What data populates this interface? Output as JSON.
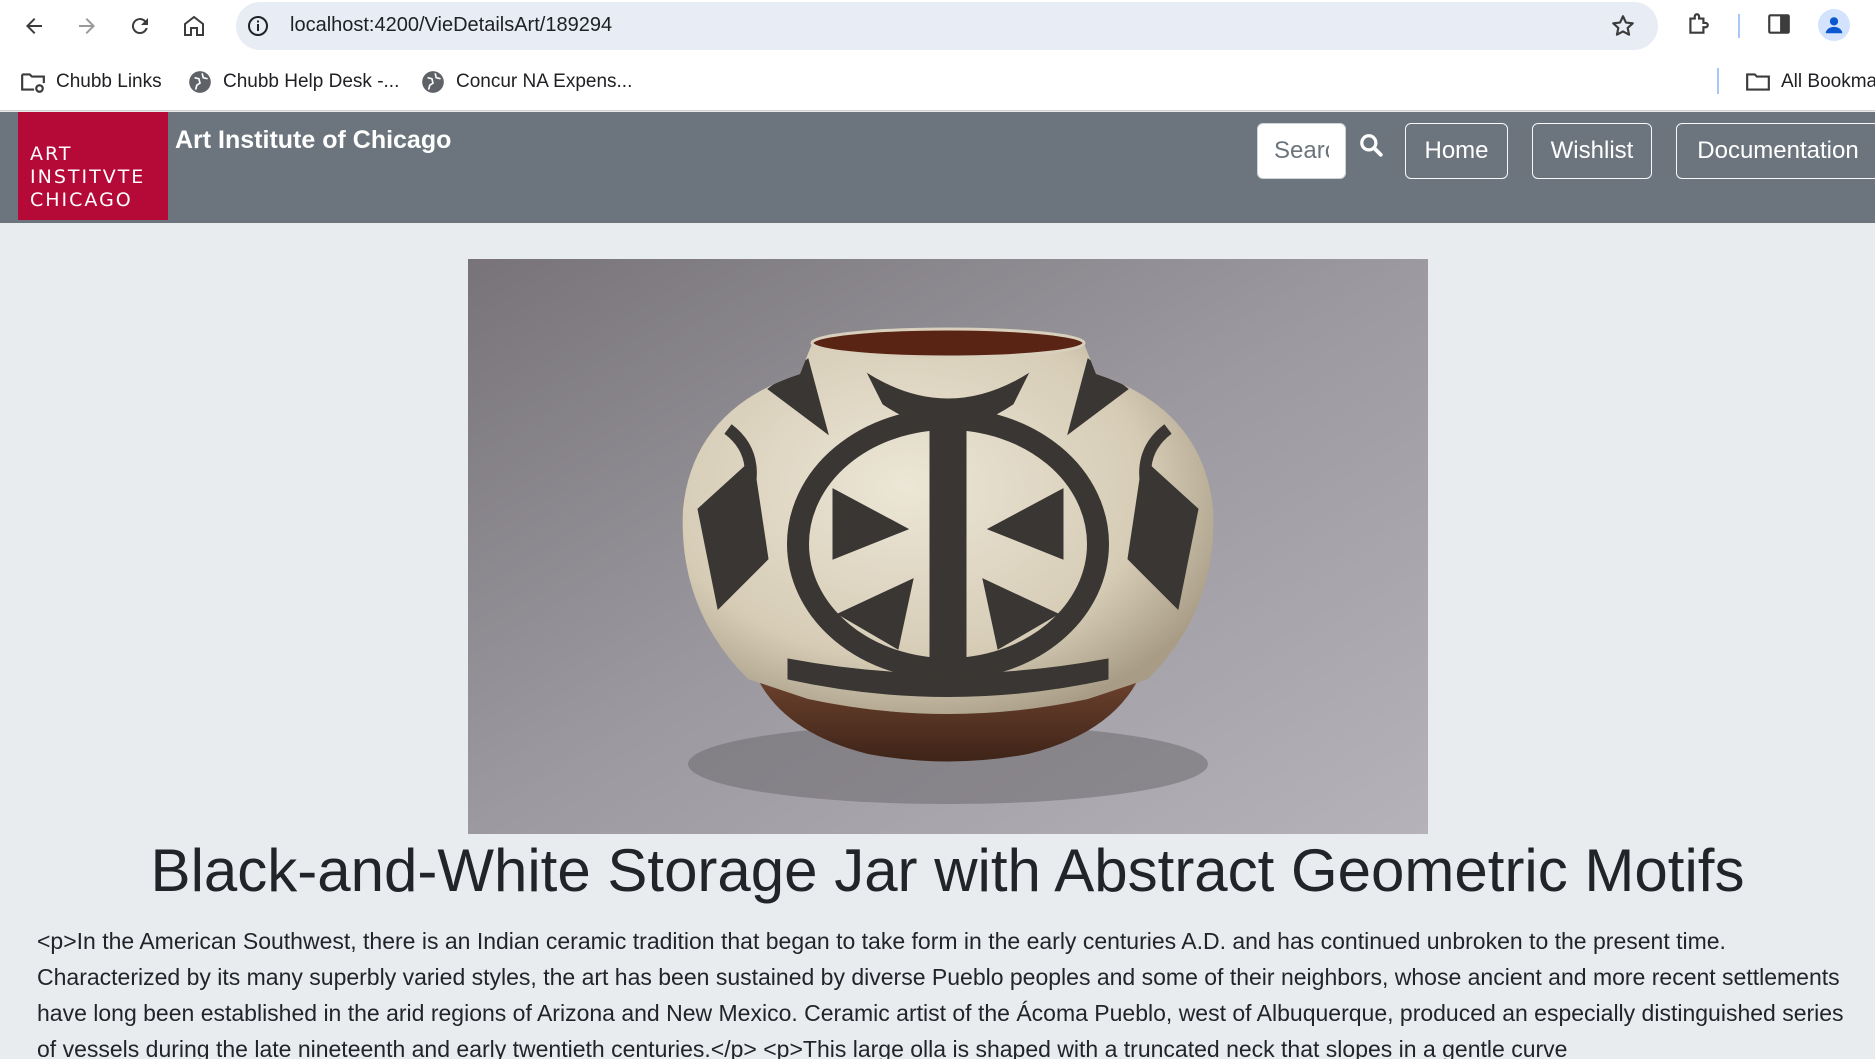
{
  "browser": {
    "url": "localhost:4200/VieDetailsArt/189294",
    "bookmarks": [
      {
        "label": "Chubb Links"
      },
      {
        "label": "Chubb Help Desk -..."
      },
      {
        "label": "Concur NA Expens..."
      }
    ],
    "all_bookmarks_label": "All Bookma"
  },
  "navbar": {
    "logo_lines": [
      "ART",
      "INSTITVTE",
      "CHICAGO"
    ],
    "brand": "Art Institute of Chicago",
    "search_placeholder": "Search",
    "links": [
      "Home",
      "Wishlist",
      "Documentation"
    ],
    "bg_color": "#6c757d",
    "logo_color": "#b50938"
  },
  "artwork": {
    "title": "Black-and-White Storage Jar with Abstract Geometric Motifs",
    "description": "<p>In the American Southwest, there is an Indian ceramic tradition that began to take form in the early centuries A.D. and has continued unbroken to the present time. Characterized by its many superbly varied styles, the art has been sustained by diverse Pueblo peoples and some of their neighbors, whose ancient and more recent settlements have long been established in the arid regions of Arizona and New Mexico. Ceramic artist of the Ácoma Pueblo, west of Albuquerque, produced an especially distinguished series of vessels during the late nineteenth and early twentieth centuries.</p> <p>This large olla is shaped with a truncated neck that slopes in a gentle curve"
  }
}
